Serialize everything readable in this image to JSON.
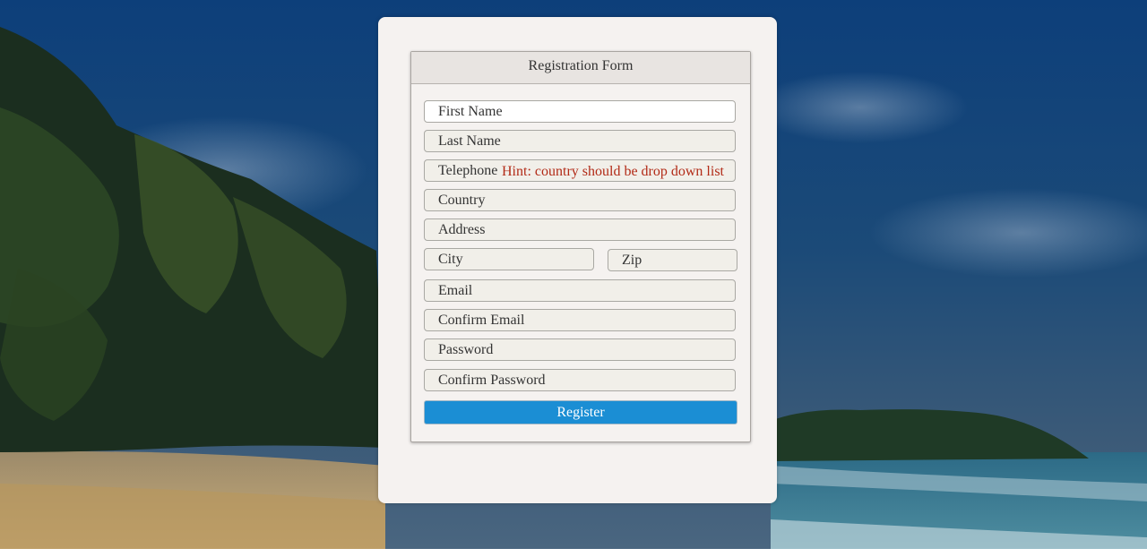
{
  "form": {
    "title": "Registration Form",
    "fields": {
      "first_name": "First Name",
      "last_name": "Last Name",
      "telephone": "Telephone",
      "country": "Country",
      "address": "Address",
      "city": "City",
      "zip": "Zip",
      "email": "Email",
      "confirm_email": "Confirm Email",
      "password": "Password",
      "confirm_password": "Confirm Password"
    },
    "hint": "Hint: country should be drop down list",
    "register_label": "Register"
  },
  "colors": {
    "accent": "#1b8ed4",
    "hint": "#b22a16",
    "card": "#f5f2f0"
  }
}
